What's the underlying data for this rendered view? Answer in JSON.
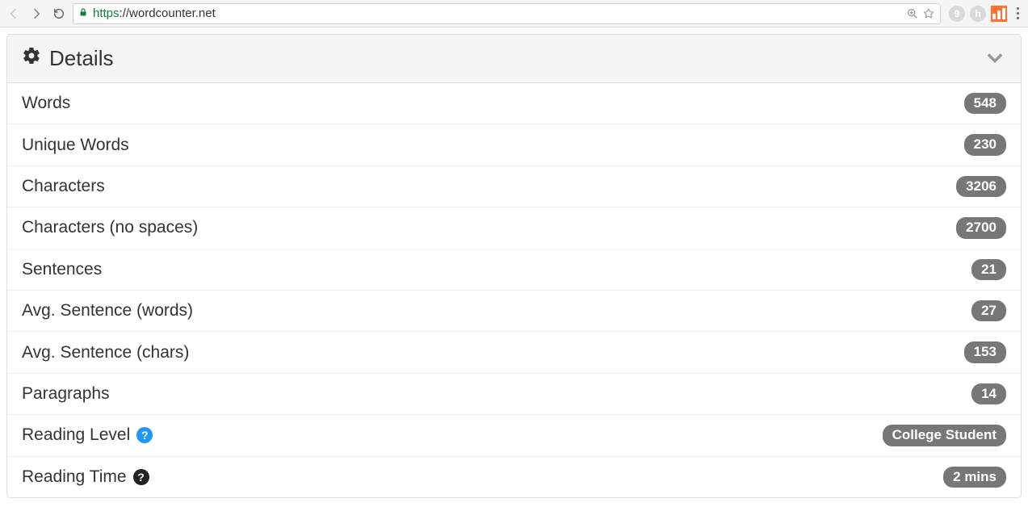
{
  "browser": {
    "url_scheme": "https",
    "url_rest": "://wordcounter.net",
    "ext1_letter": "9",
    "ext2_letter": "h"
  },
  "panel": {
    "title": "Details"
  },
  "rows": [
    {
      "label": "Words",
      "value": "548",
      "help": null
    },
    {
      "label": "Unique Words",
      "value": "230",
      "help": null
    },
    {
      "label": "Characters",
      "value": "3206",
      "help": null
    },
    {
      "label": "Characters (no spaces)",
      "value": "2700",
      "help": null
    },
    {
      "label": "Sentences",
      "value": "21",
      "help": null
    },
    {
      "label": "Avg. Sentence (words)",
      "value": "27",
      "help": null
    },
    {
      "label": "Avg. Sentence (chars)",
      "value": "153",
      "help": null
    },
    {
      "label": "Paragraphs",
      "value": "14",
      "help": null
    },
    {
      "label": "Reading Level",
      "value": "College Student",
      "help": "blue"
    },
    {
      "label": "Reading Time",
      "value": "2 mins",
      "help": "dark"
    }
  ]
}
